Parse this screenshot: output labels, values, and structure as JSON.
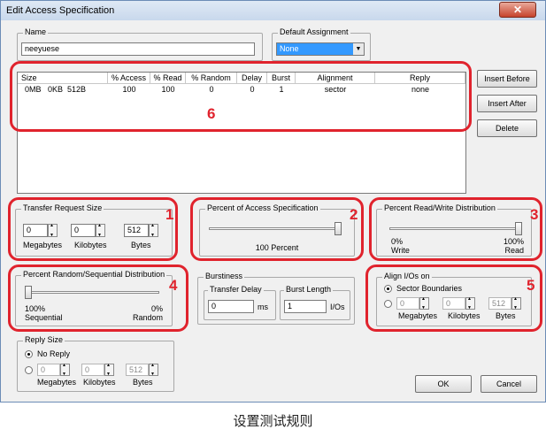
{
  "window": {
    "title": "Edit Access Specification",
    "close": "✕"
  },
  "name": {
    "label": "Name",
    "value": "neeyuese"
  },
  "default_assignment": {
    "label": "Default Assignment",
    "value": "None"
  },
  "table": {
    "headers": [
      "Size",
      "% Access",
      "% Read",
      "% Random",
      "Delay",
      "Burst",
      "Alignment",
      "Reply"
    ],
    "row": [
      "0MB   0KB  512B",
      "100",
      "100",
      "0",
      "0",
      "1",
      "sector",
      "none"
    ]
  },
  "buttons": {
    "insert_before": "Insert Before",
    "insert_after": "Insert After",
    "delete": "Delete",
    "ok": "OK",
    "cancel": "Cancel"
  },
  "transfer_size": {
    "label": "Transfer Request Size",
    "mb": "0",
    "kb": "0",
    "bytes": "512",
    "mb_label": "Megabytes",
    "kb_label": "Kilobytes",
    "bytes_label": "Bytes"
  },
  "percent_access": {
    "label": "Percent of Access Specification",
    "value_text": "100 Percent",
    "value": 100
  },
  "read_write": {
    "label": "Percent Read/Write Distribution",
    "left_pct": "0%",
    "left_label": "Write",
    "right_pct": "100%",
    "right_label": "Read",
    "value": 100
  },
  "random_seq": {
    "label": "Percent Random/Sequential Distribution",
    "left_pct": "100%",
    "left_label": "Sequential",
    "right_pct": "0%",
    "right_label": "Random",
    "value": 0
  },
  "burstiness": {
    "label": "Burstiness",
    "delay_label": "Transfer Delay",
    "delay_value": "0",
    "delay_unit": "ms",
    "burst_label": "Burst Length",
    "burst_value": "1",
    "burst_unit": "I/Os"
  },
  "align": {
    "label": "Align I/Os on",
    "sector_label": "Sector Boundaries",
    "mb": "0",
    "kb": "0",
    "bytes": "512",
    "mb_label": "Megabytes",
    "kb_label": "Kilobytes",
    "bytes_label": "Bytes"
  },
  "reply": {
    "label": "Reply Size",
    "no_reply_label": "No Reply",
    "mb": "0",
    "kb": "0",
    "bytes": "512",
    "mb_label": "Megabytes",
    "kb_label": "Kilobytes",
    "bytes_label": "Bytes"
  },
  "annotations": [
    "1",
    "2",
    "3",
    "4",
    "5",
    "6"
  ],
  "caption": "设置测试规则",
  "colors": {
    "highlight": "#e0232d",
    "selection": "#3399ff"
  }
}
